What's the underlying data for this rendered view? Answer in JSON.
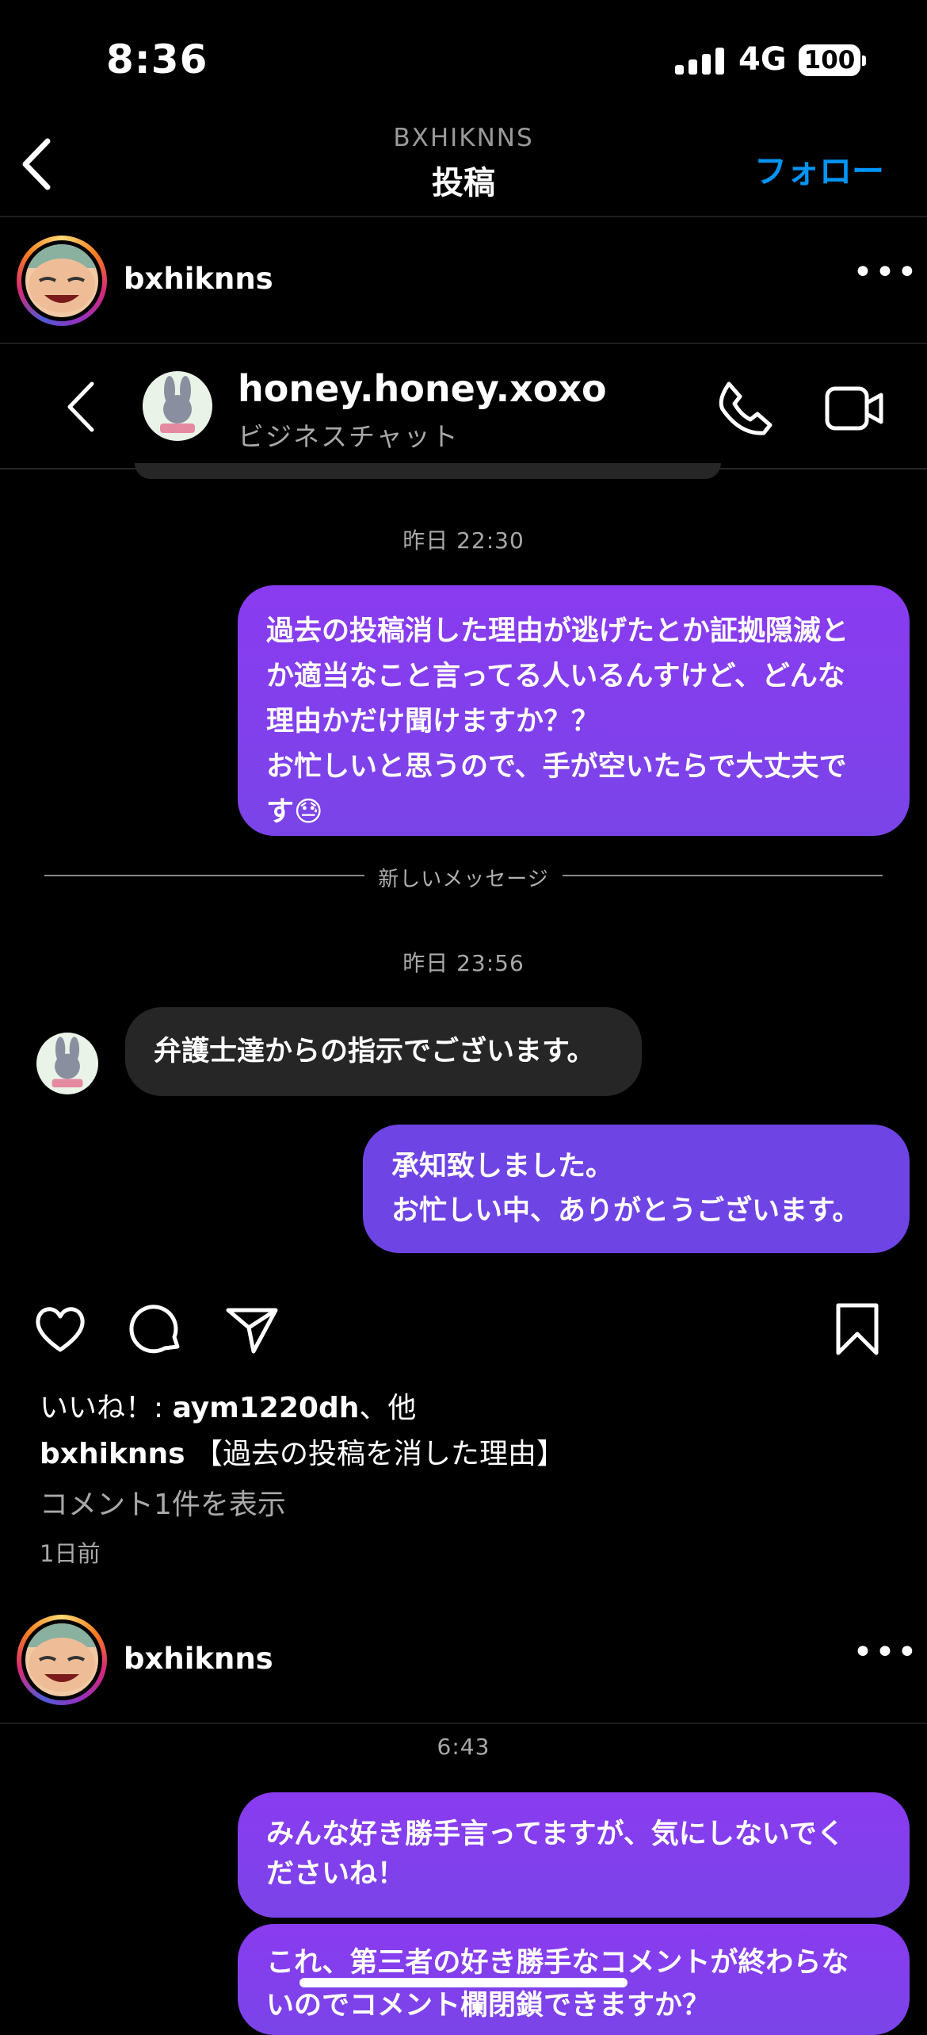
{
  "status_bar": {
    "time": "8:36",
    "network": "4G",
    "battery": "100"
  },
  "header": {
    "account": "BXHIKNNS",
    "title": "投稿",
    "follow": "フォロー"
  },
  "post_author": {
    "username": "bxhiknns"
  },
  "chat": {
    "name": "honey.honey.xoxo",
    "subtitle": "ビジネスチャット",
    "timestamp_1": "昨日 22:30",
    "msg_1_lines": [
      "過去の投稿消した理由が逃げたとか証拠隠滅と",
      "か適当なこと言ってる人いるんすけど、どんな",
      "理由かだけ聞けますか？？",
      "お忙しいと思うので、手が空いたらで大丈夫で",
      "す😓"
    ],
    "new_messages": "新しいメッセージ",
    "timestamp_2": "昨日 23:56",
    "reply_1": "弁護士達からの指示でございます。",
    "msg_2_lines": [
      "承知致しました。",
      "お忙しい中、ありがとうございます。"
    ]
  },
  "post": {
    "likes_prefix": "いいね！: ",
    "likes_user": "aym1220dh",
    "likes_suffix": "、他",
    "caption_user": "bxhiknns",
    "caption_text": "【過去の投稿を消した理由】",
    "view_comments": "コメント1件を表示",
    "age": "1日前"
  },
  "next_post": {
    "username": "bxhiknns",
    "timestamp": "6:43",
    "msg_1_lines": [
      "みんな好き勝手言ってますが、気にしないでく",
      "ださいね！"
    ],
    "msg_2_lines": [
      "これ、第三者の好き勝手なコメントが終わらな",
      "いのでコメント欄閉鎖できますか？"
    ]
  },
  "icons": [
    "back-icon",
    "more-icon",
    "phone-icon",
    "video-icon",
    "heart-icon",
    "comment-icon",
    "share-icon",
    "bookmark-icon"
  ]
}
